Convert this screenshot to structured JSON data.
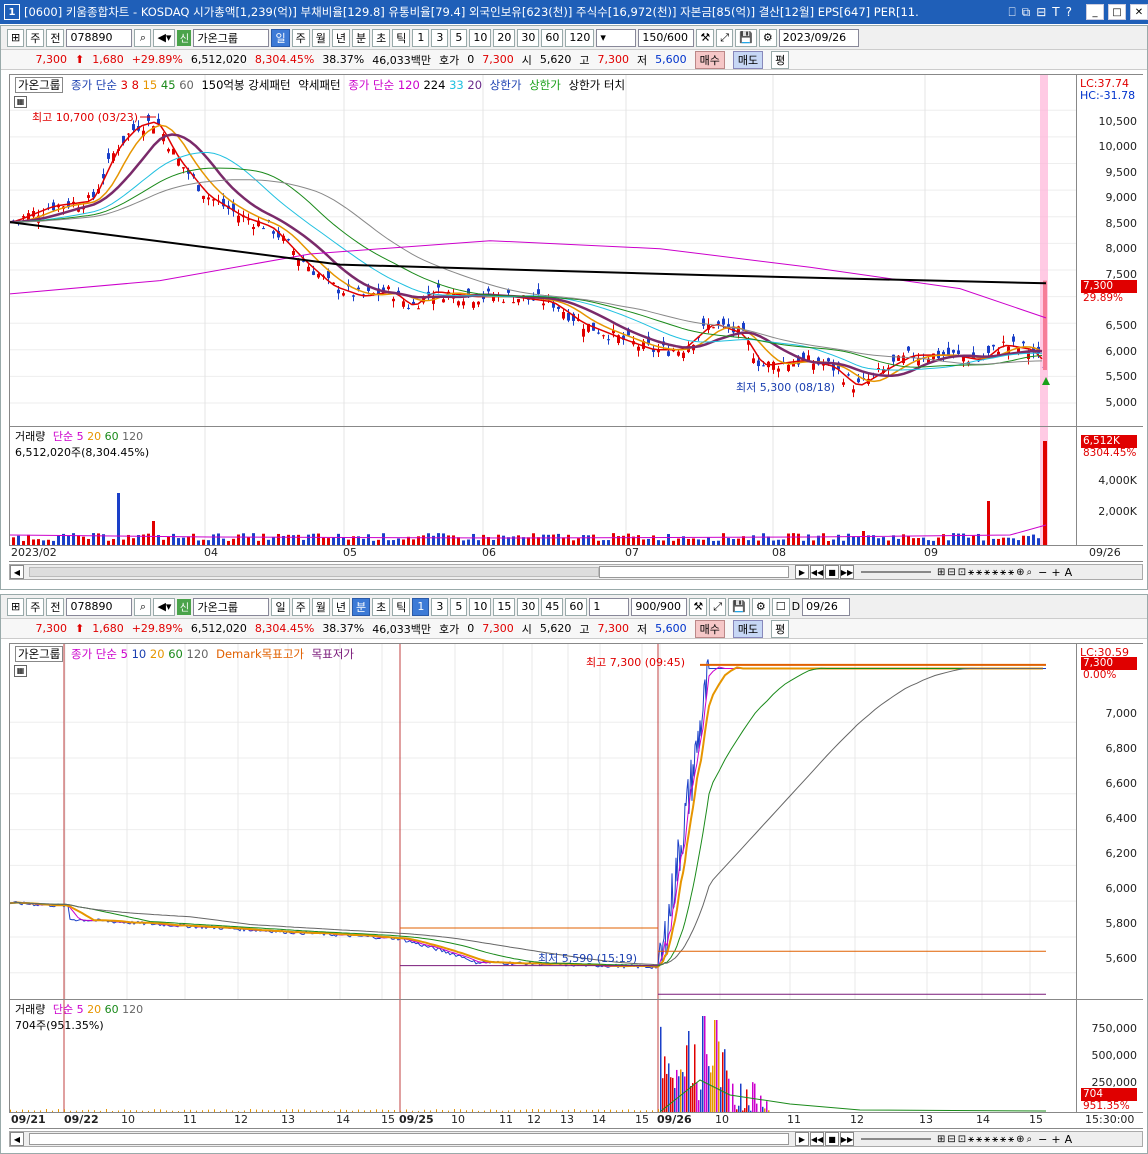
{
  "title": {
    "badge": "1",
    "text": "[0600] 키움종합차트 - KOSDAQ 시가총액[1,239(억)] 부채비율[129.8] 유통비율[79.4] 외국인보유[623(천)] 주식수[16,972(천)] 자본금[85(억)] 결산[12월] EPS[647] PER[11.",
    "controls": [
      "T",
      "?"
    ]
  },
  "top": {
    "toolbar": {
      "type": "주",
      "prev": "전",
      "code": "078890",
      "group": "가온그룹",
      "periods": [
        "일",
        "주",
        "월",
        "년",
        "분",
        "초",
        "틱"
      ],
      "active_period": "일",
      "nums": [
        "1",
        "3",
        "5",
        "10",
        "20",
        "30",
        "60",
        "120"
      ],
      "count": "150/600",
      "date": "2023/09/26"
    },
    "info": {
      "price": "7,300",
      "change": "1,680",
      "pct": "+29.89%",
      "volume": "6,512,020",
      "vol_pct": "8,304.45%",
      "turnover": "38.37%",
      "amount": "46,033백만",
      "hoga_label": "호가",
      "hoga": "0",
      "hoga_price": "7,300",
      "open_label": "시",
      "open": "5,620",
      "high_label": "고",
      "high": "7,300",
      "low_label": "저",
      "low": "5,600",
      "buy": "매수",
      "sell": "매도",
      "eval": "평"
    },
    "legend": {
      "stock": "가온그룹",
      "ma_label": "종가 단순",
      "ma": [
        "3",
        "8",
        "15",
        "45",
        "60"
      ],
      "pattern1": "150억봉 강세패턴",
      "pattern2": "약세패턴",
      "ma2_label": "종가 단순",
      "ma2": [
        "120",
        "224",
        "33",
        "20"
      ],
      "upper": "상한가",
      "upper2": "상한가",
      "upper3": "상한가 터치"
    },
    "lc": "LC:37.74",
    "hc": "HC:-31.78",
    "high_note": "최고 10,700 (03/23)",
    "low_note": "최저 5,300 (08/18)",
    "price_tag": "7,300",
    "price_tag_pct": "29.89%",
    "y_ticks": [
      "10,500",
      "10,000",
      "9,500",
      "9,000",
      "8,500",
      "8,000",
      "7,500",
      "6,500",
      "6,000",
      "5,500",
      "5,000"
    ],
    "vol_legend": {
      "label": "거래량",
      "ma_label": "단순",
      "ma": [
        "5",
        "20",
        "60",
        "120"
      ],
      "value": "6,512,020주(8,304.45%)"
    },
    "vol_tag": "6,512K",
    "vol_tag_pct": "8304.45%",
    "vol_ticks": [
      "4,000K",
      "2,000K"
    ],
    "x_labels": [
      "2023/02",
      "04",
      "05",
      "06",
      "07",
      "08",
      "09",
      "09/26"
    ]
  },
  "bottom": {
    "toolbar": {
      "type": "주",
      "prev": "전",
      "code": "078890",
      "group": "가온그룹",
      "periods": [
        "일",
        "주",
        "월",
        "년",
        "분",
        "초",
        "틱"
      ],
      "active_period": "분",
      "nums": [
        "1",
        "3",
        "5",
        "10",
        "15",
        "30",
        "45",
        "60"
      ],
      "sel": "1",
      "count": "900/900",
      "check": "D",
      "date": "09/26"
    },
    "info": {
      "price": "7,300",
      "change": "1,680",
      "pct": "+29.89%",
      "volume": "6,512,020",
      "vol_pct": "8,304.45%",
      "turnover": "38.37%",
      "amount": "46,033백만",
      "hoga_label": "호가",
      "hoga": "0",
      "hoga_price": "7,300",
      "open_label": "시",
      "open": "5,620",
      "high_label": "고",
      "high": "7,300",
      "low_label": "저",
      "low": "5,600",
      "buy": "매수",
      "sell": "매도",
      "eval": "평"
    },
    "legend": {
      "stock": "가온그룹",
      "ma_label": "종가 단순",
      "ma": [
        "5",
        "10",
        "20",
        "60",
        "120"
      ],
      "demark_high": "Demark목표고가",
      "demark_low": "목표저가"
    },
    "lc": "LC:30.59",
    "price_tag": "7,300",
    "price_tag_pct": "0.00%",
    "high_note": "최고 7,300 (09:45)",
    "low_note": "최저 5,590 (15:19)",
    "y_ticks": [
      "7,000",
      "6,800",
      "6,600",
      "6,400",
      "6,200",
      "6,000",
      "5,800",
      "5,600"
    ],
    "vol_legend": {
      "label": "거래량",
      "ma_label": "단순",
      "ma": [
        "5",
        "20",
        "60",
        "120"
      ],
      "value": "704주(951.35%)"
    },
    "vol_ticks": [
      "750,000",
      "500,000",
      "250,000"
    ],
    "vol_tag": "704",
    "vol_tag_pct": "951.35%",
    "x_labels": [
      "09/21",
      "09/22",
      "10",
      "11",
      "12",
      "13",
      "14",
      "15",
      "09/25",
      "10",
      "11",
      "12",
      "13",
      "14",
      "15",
      "09/26",
      "10",
      "11",
      "12",
      "13",
      "14",
      "15",
      "15:30:00"
    ]
  }
}
